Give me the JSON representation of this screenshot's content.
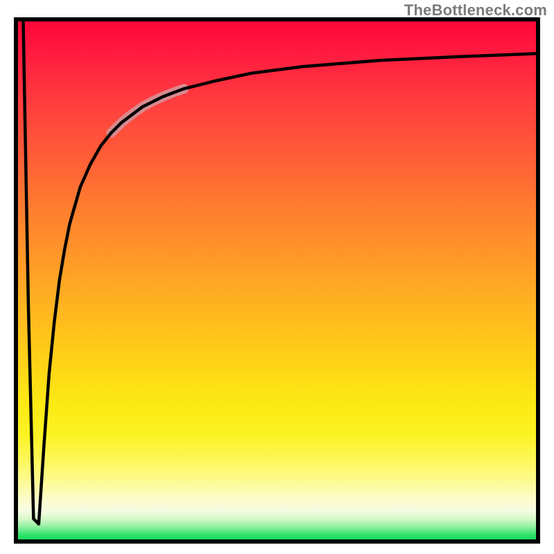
{
  "watermark": "TheBottleneck.com",
  "chart_data": {
    "type": "line",
    "title": "",
    "xlabel": "",
    "ylabel": "",
    "xlim": [
      0,
      100
    ],
    "ylim": [
      0,
      100
    ],
    "grid": false,
    "legend": false,
    "series": [
      {
        "name": "curve",
        "x": [
          1,
          2,
          3,
          4,
          5,
          6,
          7,
          8,
          9,
          10,
          12,
          14,
          16,
          18,
          20,
          24,
          28,
          32,
          38,
          45,
          55,
          70,
          85,
          100
        ],
        "y": [
          100,
          45,
          4,
          3,
          18,
          32,
          42,
          50,
          56,
          61,
          68,
          72.5,
          76,
          78.5,
          80.5,
          83.5,
          85.5,
          87,
          88.5,
          90,
          91.3,
          92.5,
          93.2,
          93.8
        ]
      },
      {
        "name": "highlight-segment",
        "x": [
          18,
          20,
          22,
          24,
          26,
          28,
          30,
          32
        ],
        "y": [
          78.5,
          80.5,
          82.1,
          83.5,
          84.6,
          85.5,
          86.3,
          87
        ]
      }
    ],
    "gradient_stops": [
      {
        "pos": 0,
        "color": "#ff073a"
      },
      {
        "pos": 15,
        "color": "#ff3b3f"
      },
      {
        "pos": 35,
        "color": "#ff7a30"
      },
      {
        "pos": 56,
        "color": "#ffb71f"
      },
      {
        "pos": 74,
        "color": "#fcea13"
      },
      {
        "pos": 89,
        "color": "#fdfb96"
      },
      {
        "pos": 96,
        "color": "#d6f9c9"
      },
      {
        "pos": 100,
        "color": "#17d85c"
      }
    ]
  }
}
